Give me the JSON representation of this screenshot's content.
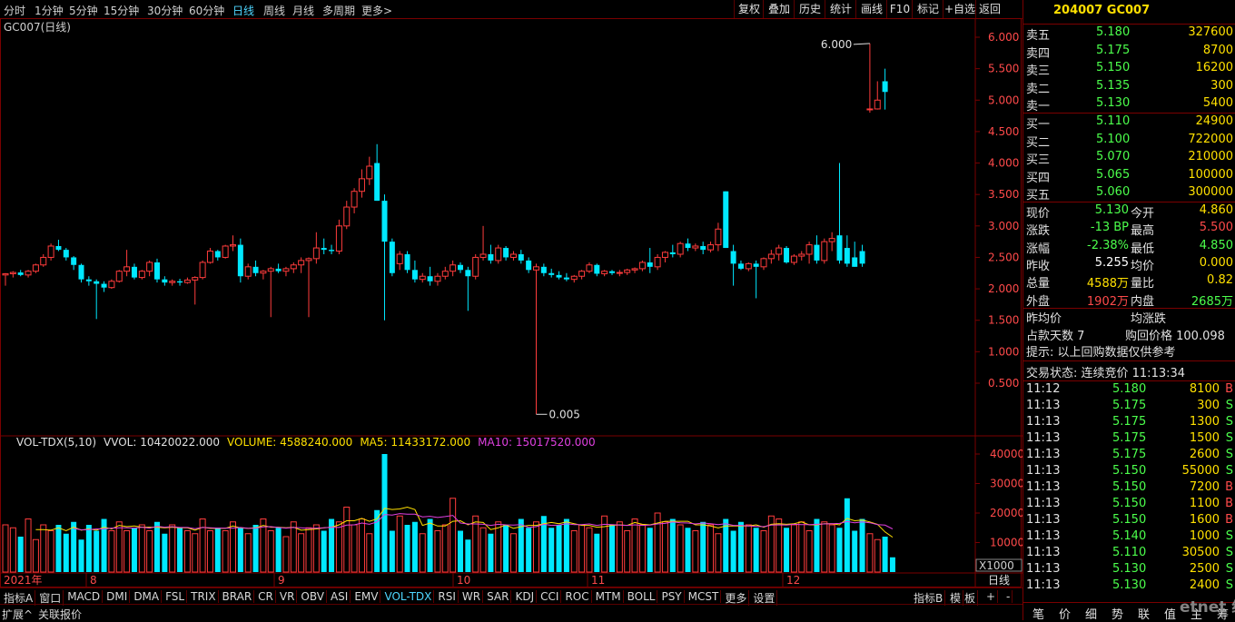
{
  "toolbar": {
    "periods": [
      "分时",
      "1分钟",
      "5分钟",
      "15分钟",
      "30分钟",
      "60分钟",
      "日线",
      "周线",
      "月线",
      "多周期",
      "更多>"
    ],
    "active_period": "日线",
    "buttons": [
      "复权",
      "叠加",
      "历史",
      "统计",
      "画线",
      "F10",
      "标记",
      "+自选",
      "返回"
    ]
  },
  "chart": {
    "symbol_label": "GC007(日线)",
    "price_axis": [
      "6.000",
      "5.500",
      "5.000",
      "4.500",
      "4.000",
      "3.500",
      "3.000",
      "2.500",
      "2.000",
      "1.500",
      "1.000",
      "0.500"
    ],
    "max_marker": "6.000",
    "min_marker": "0.005"
  },
  "volume": {
    "title": "VOL-TDX(5,10)",
    "vvol": "VVOL: 10420022.000",
    "volume": "VOLUME: 4588240.000",
    "ma5": "MA5: 11433172.000",
    "ma10": "MA10: 15017520.000",
    "axis": [
      "40000",
      "30000",
      "20000",
      "10000"
    ],
    "unit": "X1000"
  },
  "date_axis": {
    "labels": [
      "2021年",
      "8",
      "9",
      "10",
      "11",
      "12"
    ],
    "period_label": "日线"
  },
  "indicator_tabs": [
    "指标A",
    "窗口",
    "MACD",
    "DMI",
    "DMA",
    "FSL",
    "TRIX",
    "BRAR",
    "CR",
    "VR",
    "OBV",
    "ASI",
    "EMV",
    "VOL-TDX",
    "RSI",
    "WR",
    "SAR",
    "KDJ",
    "CCI",
    "ROC",
    "MTM",
    "BOLL",
    "PSY",
    "MCST",
    "更多",
    "设置"
  ],
  "active_indicator": "VOL-TDX",
  "indicator_right": [
    "指标B",
    "模",
    "板",
    "+",
    "-"
  ],
  "bottom_bar": [
    "扩展^",
    "关联报价"
  ],
  "quote": {
    "header": "204007 GC007",
    "asks": [
      {
        "label": "卖五",
        "price": "5.180",
        "vol": "327600"
      },
      {
        "label": "卖四",
        "price": "5.175",
        "vol": "8700"
      },
      {
        "label": "卖三",
        "price": "5.150",
        "vol": "16200"
      },
      {
        "label": "卖二",
        "price": "5.135",
        "vol": "300"
      },
      {
        "label": "卖一",
        "price": "5.130",
        "vol": "5400"
      }
    ],
    "bids": [
      {
        "label": "买一",
        "price": "5.110",
        "vol": "24900"
      },
      {
        "label": "买二",
        "price": "5.100",
        "vol": "722000"
      },
      {
        "label": "买三",
        "price": "5.070",
        "vol": "210000"
      },
      {
        "label": "买四",
        "price": "5.065",
        "vol": "100000"
      },
      {
        "label": "买五",
        "price": "5.060",
        "vol": "300000"
      }
    ],
    "stats": [
      {
        "l1": "现价",
        "v1": "5.130",
        "l2": "今开",
        "v2": "4.860"
      },
      {
        "l1": "涨跌",
        "v1": "-13 BP",
        "l2": "最高",
        "v2": "5.500"
      },
      {
        "l1": "涨幅",
        "v1": "-2.38%",
        "l2": "最低",
        "v2": "4.850"
      },
      {
        "l1": "昨收",
        "v1": "5.255",
        "l2": "均价",
        "v2": "0.000"
      },
      {
        "l1": "总量",
        "v1": "4588万",
        "l2": "量比",
        "v2": "0.82"
      },
      {
        "l1": "外盘",
        "v1": "1902万",
        "l2": "内盘",
        "v2": "2685万"
      }
    ],
    "info1": "昨均价",
    "info2": "均涨跌",
    "info3": "占款天数 7",
    "info4": "购回价格 100.098",
    "hint": "提示: 以上回购数据仅供参考",
    "trade_status": "交易状态: 连续竞价 11:13:34",
    "ticks": [
      {
        "t": "11:12",
        "p": "5.180",
        "v": "8100",
        "s": "B"
      },
      {
        "t": "11:13",
        "p": "5.175",
        "v": "300",
        "s": "S"
      },
      {
        "t": "11:13",
        "p": "5.175",
        "v": "1300",
        "s": "S"
      },
      {
        "t": "11:13",
        "p": "5.175",
        "v": "1500",
        "s": "S"
      },
      {
        "t": "11:13",
        "p": "5.175",
        "v": "2600",
        "s": "S"
      },
      {
        "t": "11:13",
        "p": "5.150",
        "v": "55000",
        "s": "S"
      },
      {
        "t": "11:13",
        "p": "5.150",
        "v": "7200",
        "s": "B"
      },
      {
        "t": "11:13",
        "p": "5.150",
        "v": "1100",
        "s": "B"
      },
      {
        "t": "11:13",
        "p": "5.150",
        "v": "1600",
        "s": "B"
      },
      {
        "t": "11:13",
        "p": "5.140",
        "v": "1000",
        "s": "S"
      },
      {
        "t": "11:13",
        "p": "5.110",
        "v": "30500",
        "s": "S"
      },
      {
        "t": "11:13",
        "p": "5.130",
        "v": "2500",
        "s": "S"
      },
      {
        "t": "11:13",
        "p": "5.130",
        "v": "2400",
        "s": "S"
      }
    ],
    "bottom_tabs": [
      "笔",
      "价",
      "细",
      "势",
      "联",
      "值",
      "主",
      "筹"
    ],
    "watermark": "etnet 经济通"
  },
  "colors": {
    "up": "#ff3c3c",
    "down": "#00e8ff",
    "grid": "#7a0000",
    "ma5": "#ffe000",
    "ma10": "#e040e0"
  },
  "chart_data": {
    "type": "candlestick",
    "candles": [
      [
        2.22,
        2.25,
        2.05,
        2.24
      ],
      [
        2.24,
        2.28,
        2.18,
        2.26
      ],
      [
        2.26,
        2.3,
        2.2,
        2.22
      ],
      [
        2.22,
        2.3,
        2.18,
        2.28
      ],
      [
        2.28,
        2.4,
        2.25,
        2.38
      ],
      [
        2.38,
        2.55,
        2.35,
        2.5
      ],
      [
        2.5,
        2.72,
        2.45,
        2.68
      ],
      [
        2.68,
        2.78,
        2.6,
        2.62
      ],
      [
        2.62,
        2.65,
        2.45,
        2.5
      ],
      [
        2.5,
        2.52,
        2.3,
        2.38
      ],
      [
        2.38,
        2.4,
        2.1,
        2.15
      ],
      [
        2.15,
        2.2,
        2.05,
        2.12
      ],
      [
        2.12,
        2.15,
        1.52,
        2.08
      ],
      [
        2.08,
        2.12,
        1.95,
        2.02
      ],
      [
        2.02,
        2.15,
        2.0,
        2.12
      ],
      [
        2.12,
        2.3,
        2.1,
        2.28
      ],
      [
        2.28,
        2.62,
        2.2,
        2.35
      ],
      [
        2.35,
        2.4,
        2.15,
        2.18
      ],
      [
        2.18,
        2.3,
        2.15,
        2.28
      ],
      [
        2.28,
        2.45,
        2.2,
        2.42
      ],
      [
        2.42,
        2.48,
        2.1,
        2.15
      ],
      [
        2.15,
        2.2,
        2.05,
        2.1
      ],
      [
        2.1,
        2.15,
        2.05,
        2.12
      ],
      [
        2.12,
        2.16,
        2.05,
        2.1
      ],
      [
        2.1,
        2.18,
        2.08,
        2.14
      ],
      [
        2.14,
        2.2,
        1.75,
        2.18
      ],
      [
        2.18,
        2.45,
        2.15,
        2.42
      ],
      [
        2.42,
        2.65,
        2.4,
        2.6
      ],
      [
        2.6,
        2.62,
        2.45,
        2.5
      ],
      [
        2.5,
        2.7,
        2.48,
        2.68
      ],
      [
        2.68,
        2.85,
        2.6,
        2.7
      ],
      [
        2.7,
        2.8,
        2.1,
        2.2
      ],
      [
        2.2,
        2.4,
        2.15,
        2.35
      ],
      [
        2.35,
        2.45,
        2.2,
        2.25
      ],
      [
        2.25,
        2.3,
        2.15,
        2.28
      ],
      [
        2.28,
        2.35,
        1.55,
        2.32
      ],
      [
        2.32,
        2.4,
        2.25,
        2.28
      ],
      [
        2.28,
        2.35,
        2.2,
        2.32
      ],
      [
        2.32,
        2.42,
        2.25,
        2.38
      ],
      [
        2.38,
        2.5,
        2.25,
        2.45
      ],
      [
        2.45,
        2.5,
        1.55,
        2.48
      ],
      [
        2.48,
        2.9,
        2.4,
        2.65
      ],
      [
        2.65,
        2.8,
        2.55,
        2.62
      ],
      [
        2.62,
        2.7,
        2.55,
        2.6
      ],
      [
        2.6,
        3.1,
        2.55,
        3.0
      ],
      [
        3.0,
        3.4,
        2.95,
        3.3
      ],
      [
        3.3,
        3.6,
        3.2,
        3.55
      ],
      [
        3.55,
        3.9,
        3.45,
        3.75
      ],
      [
        3.75,
        4.1,
        3.65,
        3.95
      ],
      [
        4.0,
        4.3,
        3.4,
        3.4
      ],
      [
        3.4,
        3.5,
        1.5,
        2.75
      ],
      [
        2.75,
        2.8,
        2.2,
        2.25
      ],
      [
        2.4,
        2.6,
        2.3,
        2.55
      ],
      [
        2.55,
        2.6,
        2.25,
        2.3
      ],
      [
        2.3,
        2.45,
        2.1,
        2.15
      ],
      [
        2.15,
        2.25,
        2.1,
        2.2
      ],
      [
        2.2,
        2.35,
        2.05,
        2.12
      ],
      [
        2.12,
        2.25,
        2.05,
        2.2
      ],
      [
        2.2,
        2.35,
        2.15,
        2.28
      ],
      [
        2.28,
        2.45,
        2.2,
        2.38
      ],
      [
        2.38,
        2.42,
        2.25,
        2.3
      ],
      [
        2.3,
        2.35,
        1.65,
        2.2
      ],
      [
        2.2,
        2.55,
        2.15,
        2.5
      ],
      [
        2.5,
        3.0,
        2.45,
        2.55
      ],
      [
        2.55,
        2.7,
        2.4,
        2.45
      ],
      [
        2.45,
        2.7,
        2.4,
        2.65
      ],
      [
        2.65,
        2.68,
        2.45,
        2.5
      ],
      [
        2.5,
        2.6,
        2.45,
        2.55
      ],
      [
        2.55,
        2.62,
        2.4,
        2.45
      ],
      [
        2.45,
        2.5,
        2.25,
        2.3
      ],
      [
        2.3,
        2.4,
        0.005,
        2.35
      ],
      [
        2.35,
        2.4,
        2.2,
        2.25
      ],
      [
        2.25,
        2.32,
        2.18,
        2.22
      ],
      [
        2.22,
        2.28,
        2.15,
        2.18
      ],
      [
        2.18,
        2.25,
        2.12,
        2.15
      ],
      [
        2.15,
        2.22,
        2.1,
        2.2
      ],
      [
        2.2,
        2.3,
        2.15,
        2.28
      ],
      [
        2.28,
        2.42,
        2.25,
        2.38
      ],
      [
        2.38,
        2.4,
        2.2,
        2.24
      ],
      [
        2.24,
        2.3,
        2.2,
        2.28
      ],
      [
        2.28,
        2.3,
        2.22,
        2.25
      ],
      [
        2.25,
        2.3,
        2.2,
        2.26
      ],
      [
        2.26,
        2.32,
        2.22,
        2.3
      ],
      [
        2.3,
        2.34,
        2.25,
        2.32
      ],
      [
        2.32,
        2.45,
        2.28,
        2.42
      ],
      [
        2.42,
        2.65,
        2.25,
        2.35
      ],
      [
        2.35,
        2.55,
        2.3,
        2.5
      ],
      [
        2.5,
        2.6,
        2.42,
        2.58
      ],
      [
        2.58,
        2.7,
        2.5,
        2.55
      ],
      [
        2.55,
        2.75,
        2.5,
        2.72
      ],
      [
        2.72,
        2.8,
        2.6,
        2.65
      ],
      [
        2.65,
        2.72,
        2.6,
        2.68
      ],
      [
        2.68,
        2.75,
        2.55,
        2.62
      ],
      [
        2.62,
        2.75,
        2.58,
        2.7
      ],
      [
        2.7,
        3.05,
        2.6,
        2.95
      ],
      [
        3.55,
        3.55,
        2.65,
        2.65
      ],
      [
        2.6,
        2.7,
        2.05,
        2.4
      ],
      [
        2.4,
        2.45,
        2.3,
        2.32
      ],
      [
        2.32,
        2.42,
        2.28,
        2.4
      ],
      [
        2.4,
        2.45,
        1.85,
        2.35
      ],
      [
        2.35,
        2.5,
        2.3,
        2.48
      ],
      [
        2.48,
        2.62,
        2.4,
        2.55
      ],
      [
        2.55,
        2.7,
        2.45,
        2.65
      ],
      [
        2.65,
        2.68,
        2.4,
        2.42
      ],
      [
        2.42,
        2.55,
        2.38,
        2.52
      ],
      [
        2.52,
        2.6,
        2.45,
        2.55
      ],
      [
        2.55,
        2.75,
        2.4,
        2.7
      ],
      [
        2.7,
        2.85,
        2.4,
        2.45
      ],
      [
        2.45,
        2.8,
        2.4,
        2.75
      ],
      [
        2.75,
        2.9,
        2.6,
        2.8
      ],
      [
        2.85,
        4.0,
        2.4,
        2.45
      ],
      [
        2.65,
        2.85,
        2.35,
        2.4
      ],
      [
        2.5,
        2.75,
        2.35,
        2.35
      ],
      [
        2.6,
        2.7,
        2.35,
        2.4
      ],
      [
        4.86,
        5.9,
        4.8,
        4.86
      ],
      [
        4.86,
        5.3,
        4.85,
        5.0
      ],
      [
        5.3,
        5.5,
        4.85,
        5.13
      ]
    ],
    "volumes": [
      16,
      15,
      12,
      18,
      11,
      16,
      14,
      16,
      13,
      17,
      11,
      16,
      14,
      18,
      14,
      17,
      14,
      15,
      16,
      14,
      17,
      13,
      16,
      15,
      14,
      13,
      18,
      14,
      15,
      14,
      17,
      15,
      13,
      16,
      18,
      14,
      15,
      12,
      17,
      13,
      15,
      16,
      14,
      18,
      17,
      22,
      16,
      18,
      13,
      21,
      40,
      14,
      19,
      16,
      17,
      13,
      18,
      14,
      16,
      25,
      14,
      11,
      19,
      15,
      13,
      17,
      16,
      13,
      18,
      15,
      17,
      19,
      15,
      16,
      18,
      14,
      16,
      15,
      13,
      19,
      16,
      17,
      14,
      18,
      16,
      15,
      20,
      17,
      18,
      16,
      15,
      14,
      17,
      16,
      13,
      18,
      14,
      17,
      16,
      15,
      14,
      19,
      18,
      15,
      16,
      17,
      14,
      18,
      17,
      16,
      15,
      25,
      14,
      18,
      13,
      11,
      12,
      5
    ],
    "volume_unit": "X1000",
    "ma5_label": "MA5",
    "ma10_label": "MA10"
  }
}
